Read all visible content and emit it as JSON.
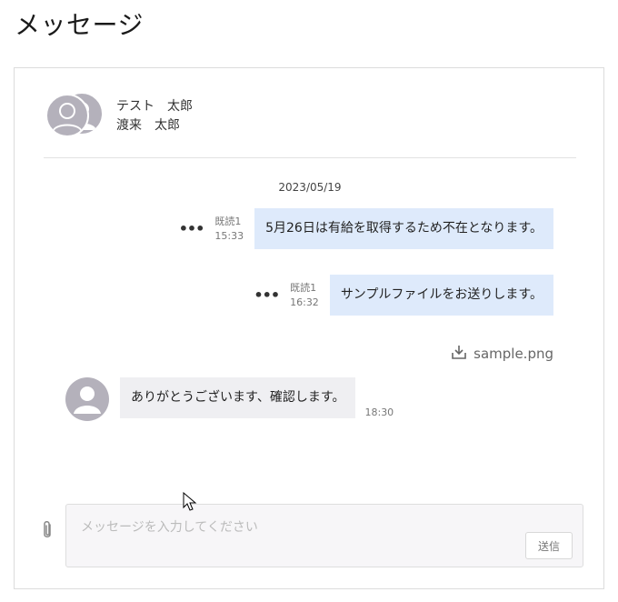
{
  "page": {
    "title": "メッセージ"
  },
  "header": {
    "participants": [
      "テスト　太郎",
      "渡来　太郎"
    ]
  },
  "thread": {
    "date": "2023/05/19",
    "messages": [
      {
        "direction": "out",
        "status": "既読1",
        "time": "15:33",
        "text": "5月26日は有給を取得するため不在となります。"
      },
      {
        "direction": "out",
        "status": "既読1",
        "time": "16:32",
        "text": "サンプルファイルをお送りします。"
      },
      {
        "direction": "out",
        "attachment": "sample.png"
      },
      {
        "direction": "in",
        "time": "18:30",
        "text": "ありがとうございます、確認します。"
      }
    ],
    "more_icon": "more-horizontal-icon"
  },
  "composer": {
    "placeholder": "メッセージを入力してください",
    "value": "",
    "send_label": "送信",
    "attach_icon": "paperclip-icon"
  },
  "colors": {
    "outgoing_bubble": "#deeafb",
    "incoming_bubble": "#efeff2",
    "avatar": "#b4b1bb"
  }
}
